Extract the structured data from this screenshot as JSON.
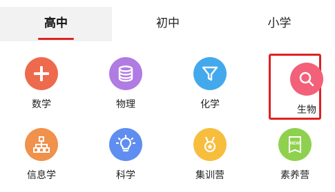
{
  "tabs": [
    {
      "label": "高中",
      "active": true
    },
    {
      "label": "初中",
      "active": false
    },
    {
      "label": "小学",
      "active": false
    }
  ],
  "subjects": [
    {
      "label": "数学",
      "icon": "plus-icon",
      "color": "#ee6a4d"
    },
    {
      "label": "物理",
      "icon": "database-icon",
      "color": "#b07be3"
    },
    {
      "label": "化学",
      "icon": "funnel-icon",
      "color": "#43a9ec"
    },
    {
      "label": "生物",
      "icon": "search-icon",
      "color": "#f3607a",
      "selected": true
    },
    {
      "label": "信息学",
      "icon": "sitemap-icon",
      "color": "#f0914c"
    },
    {
      "label": "科学",
      "icon": "lightbulb-icon",
      "color": "#5f8ef0"
    },
    {
      "label": "集训营",
      "icon": "medal-icon",
      "color": "#f7bd3d"
    },
    {
      "label": "素养营",
      "icon": "new-badge-icon",
      "color": "#8fd14f"
    }
  ],
  "accent_color": "#e02020"
}
